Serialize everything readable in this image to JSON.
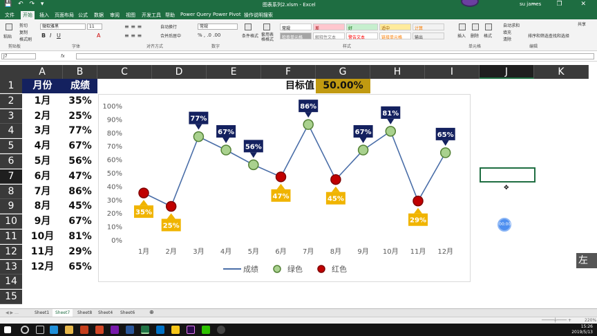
{
  "window": {
    "title": "图表系列2.xlsm - Excel",
    "user": "su james",
    "controls": "—  ❐  ✕",
    "quick_access": "💾 ↶ ↷ ▾"
  },
  "ribbon_tabs": [
    "文件",
    "开始",
    "插入",
    "页面布局",
    "公式",
    "数据",
    "审阅",
    "视图",
    "开发工具",
    "帮助",
    "Power Query",
    "Power Pivot",
    "操作说明搜索"
  ],
  "ribbon": {
    "clipboard": {
      "cut": "剪切",
      "copy": "复制",
      "painter": "格式刷",
      "paste": "粘贴",
      "group": "剪贴板"
    },
    "font": {
      "name": "微软雅黑",
      "size": "11",
      "group": "字体"
    },
    "alignment": {
      "wrap": "自动换行",
      "merge": "合并后居中",
      "group": "对齐方式"
    },
    "number": {
      "format": "常规",
      "group": "数字"
    },
    "styles": {
      "cond": "条件格式",
      "table": "套用表格格式",
      "group": "样式",
      "cells": [
        {
          "label": "常规",
          "bg": "#ffffff",
          "fg": "#000000"
        },
        {
          "label": "差",
          "bg": "#ffc7ce",
          "fg": "#9c0006"
        },
        {
          "label": "好",
          "bg": "#c6efce",
          "fg": "#006100"
        },
        {
          "label": "适中",
          "bg": "#ffeb9c",
          "fg": "#9c5700"
        },
        {
          "label": "计算",
          "bg": "#f2f2f2",
          "fg": "#fa7d00"
        },
        {
          "label": "检查单元格",
          "bg": "#a5a5a5",
          "fg": "#ffffff"
        },
        {
          "label": "解释性文本",
          "bg": "#ffffff",
          "fg": "#7f7f7f"
        },
        {
          "label": "警告文本",
          "bg": "#ffffff",
          "fg": "#ff0000"
        },
        {
          "label": "链接单元格",
          "bg": "#ffffff",
          "fg": "#fa7d00"
        },
        {
          "label": "输出",
          "bg": "#f2f2f2",
          "fg": "#3f3f3f"
        }
      ]
    },
    "cells_group": {
      "insert": "插入",
      "delete": "删除",
      "format": "格式",
      "group": "单元格"
    },
    "editing": {
      "autosum": "自动求和",
      "fill": "填充",
      "clear": "清除",
      "sort": "排序和筛选",
      "find": "查找和选择",
      "group": "编辑"
    },
    "share": "共享"
  },
  "formula_bar": {
    "name_box": "J7",
    "fx": "fx",
    "value": ""
  },
  "columns": [
    "A",
    "B",
    "C",
    "D",
    "E",
    "F",
    "G",
    "H",
    "I",
    "J",
    "K"
  ],
  "selected_column": "J",
  "rows": [
    "1",
    "2",
    "3",
    "4",
    "5",
    "6",
    "7",
    "8",
    "9",
    "10",
    "11",
    "12",
    "13",
    "14",
    "15"
  ],
  "selected_row": "7",
  "sheet": {
    "header_month": "月份",
    "header_score": "成绩",
    "target_label": "目标值",
    "target_value": "50.00%",
    "data": [
      {
        "month": "1月",
        "score": "35%"
      },
      {
        "month": "2月",
        "score": "25%"
      },
      {
        "month": "3月",
        "score": "77%"
      },
      {
        "month": "4月",
        "score": "67%"
      },
      {
        "month": "5月",
        "score": "56%"
      },
      {
        "month": "6月",
        "score": "47%"
      },
      {
        "month": "7月",
        "score": "86%"
      },
      {
        "month": "8月",
        "score": "45%"
      },
      {
        "month": "9月",
        "score": "67%"
      },
      {
        "month": "10月",
        "score": "81%"
      },
      {
        "month": "11月",
        "score": "29%"
      },
      {
        "month": "12月",
        "score": "65%"
      }
    ]
  },
  "chart_data": {
    "type": "line",
    "categories": [
      "1月",
      "2月",
      "3月",
      "4月",
      "5月",
      "6月",
      "7月",
      "8月",
      "9月",
      "10月",
      "11月",
      "12月"
    ],
    "series": [
      {
        "name": "成绩",
        "values": [
          35,
          25,
          77,
          67,
          56,
          47,
          86,
          45,
          67,
          81,
          29,
          65
        ]
      }
    ],
    "target": 50,
    "ylim": [
      0,
      100
    ],
    "yticks": [
      "0%",
      "10%",
      "20%",
      "30%",
      "40%",
      "50%",
      "60%",
      "70%",
      "80%",
      "90%",
      "100%"
    ],
    "labels": [
      "35%",
      "25%",
      "77%",
      "67%",
      "56%",
      "47%",
      "86%",
      "45%",
      "67%",
      "81%",
      "29%",
      "65%"
    ],
    "legend": [
      "成绩",
      "绿色",
      "红色"
    ],
    "legend_position": "bottom",
    "colors": {
      "line": "#4a6ea8",
      "above_fill": "#a9d18e",
      "above_stroke": "#538135",
      "below_fill": "#c00000",
      "below_stroke": "#7f0000",
      "above_label": "#14215f",
      "below_label": "#f0b400"
    }
  },
  "sheet_tabs": [
    "Sheet1",
    "Sheet7",
    "Sheet8",
    "Sheet4",
    "Sheet6"
  ],
  "active_sheet": "Sheet7",
  "status": {
    "zoom": "220%"
  },
  "overlay": {
    "badge": "00:00",
    "side_text": "左键"
  },
  "taskbar": {
    "time": "15:26",
    "date": "2019/5/13"
  }
}
